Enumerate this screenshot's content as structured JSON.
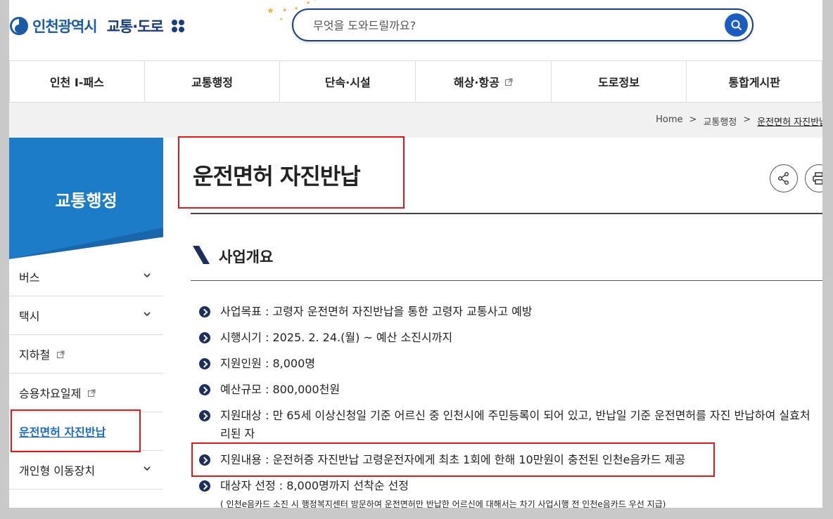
{
  "header": {
    "brand": "인천광역시",
    "section": "교통·도로",
    "search_placeholder": "무엇을 도와드릴까요?"
  },
  "nav": {
    "items": [
      {
        "label": "인천 I-패스",
        "external": false
      },
      {
        "label": "교통행정",
        "external": false
      },
      {
        "label": "단속·시설",
        "external": false
      },
      {
        "label": "해상·항공",
        "external": true
      },
      {
        "label": "도로정보",
        "external": false
      },
      {
        "label": "통합게시판",
        "external": false
      }
    ]
  },
  "breadcrumb": {
    "home": "Home",
    "sep": ">",
    "level1": "교통행정",
    "current": "운전면허 자진반납"
  },
  "sidebar": {
    "title": "교통행정",
    "items": [
      {
        "label": "버스",
        "type": "expand"
      },
      {
        "label": "택시",
        "type": "expand"
      },
      {
        "label": "지하철",
        "type": "external"
      },
      {
        "label": "승용차요일제",
        "type": "external"
      },
      {
        "label": "운전면허 자진반납",
        "type": "active"
      },
      {
        "label": "개인형 이동장치",
        "type": "expand"
      }
    ]
  },
  "content": {
    "title": "운전면허 자진반납",
    "section_title": "사업개요",
    "items": [
      "사업목표 : 고령자 운전면허 자진반납을 통한 고령자 교통사고 예방",
      "시행시기 : 2025. 2. 24.(월) ~ 예산 소진시까지",
      "지원인원 : 8,000명",
      "예산규모 : 800,000천원",
      "지원대상 : 만 65세 이상신청일 기준 어르신 중 인천시에 주민등록이 되어 있고, 반납일 기준 운전면허를 자진 반납하여 실효처리된 자",
      "지원내용 : 운전허증 자진반납 고령운전자에게 최초 1회에 한해 10만원이 충전된 인천e음카드 제공",
      "대상자 선정 : 8,000명까지 선착순 선정"
    ],
    "note": "( 인천e음카드 소진 시 행정복지센터 방문하여 운전면허만 반납한 어르신에 대해서는 차기 사업시행 전 인천e음카드  우선 지급)"
  },
  "colors": {
    "brand_blue": "#1c7cc7",
    "navy": "#1b2e5e",
    "highlight_red": "#e0181e"
  }
}
